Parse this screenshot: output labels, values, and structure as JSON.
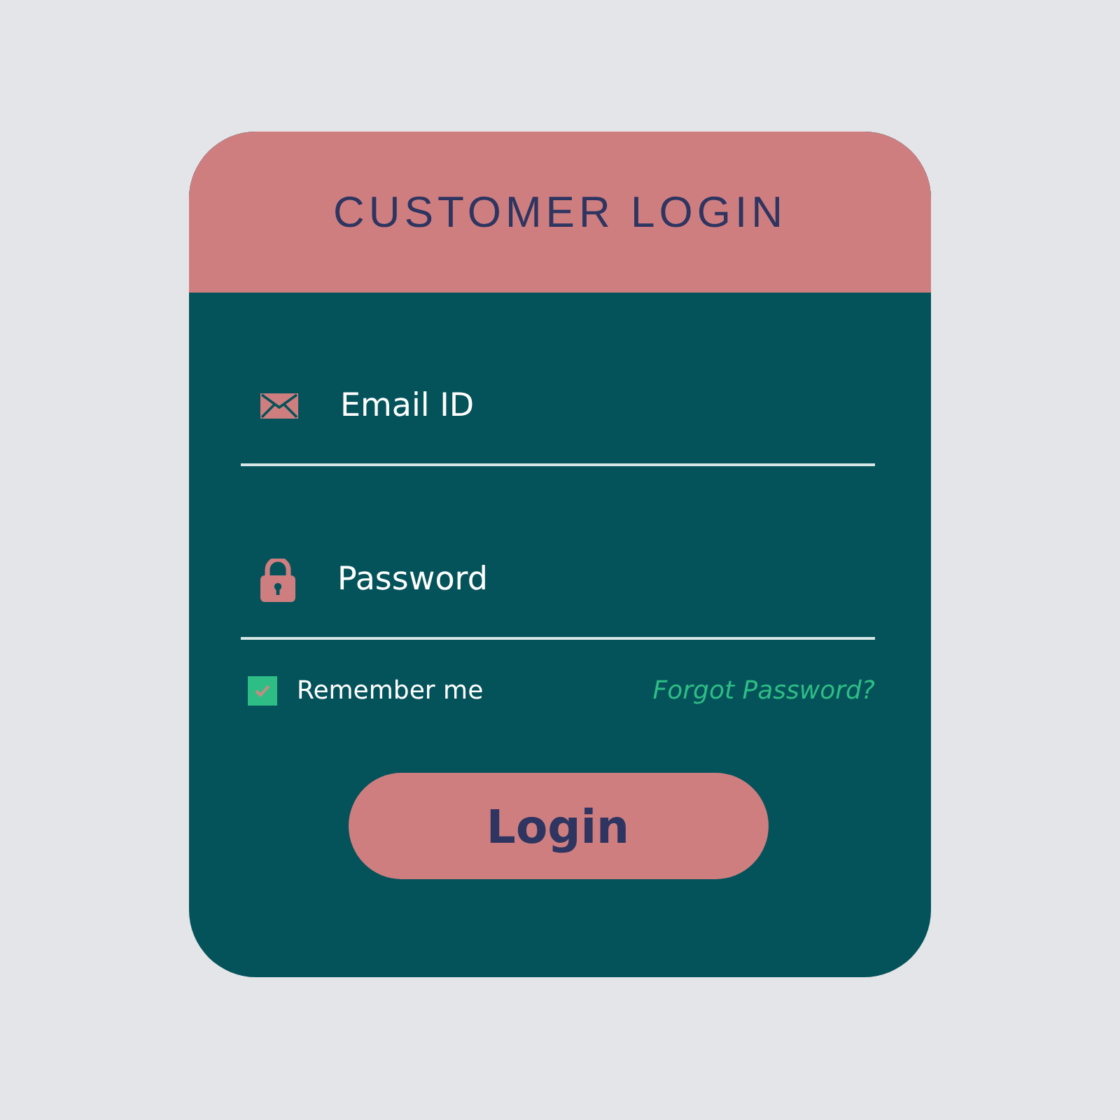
{
  "card": {
    "title": "CUSTOMER LOGIN"
  },
  "fields": [
    {
      "kind": "email",
      "placeholder": "Email ID"
    },
    {
      "kind": "password",
      "placeholder": "Password"
    }
  ],
  "remember": {
    "label": "Remember me",
    "checked": true
  },
  "forgot_link": "Forgot Password?",
  "login_button": "Login"
}
